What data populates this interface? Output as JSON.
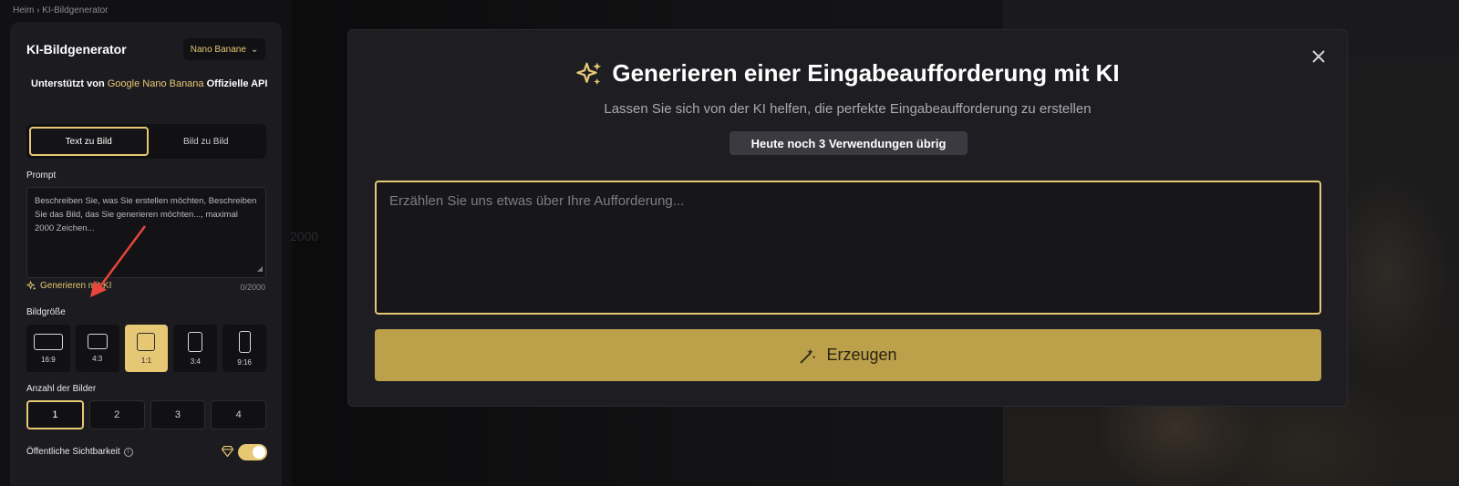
{
  "breadcrumb": "Heim › KI-Bildgenerator",
  "background": {
    "ghost_number": "2000"
  },
  "panel": {
    "title": "KI-Bildgenerator",
    "model_select": "Nano Banane",
    "powered_prefix": "Unterstützt von",
    "powered_brand": "Google Nano Banana",
    "powered_suffix": "Offizielle API",
    "tabs": [
      "Text zu Bild",
      "Bild zu Bild"
    ],
    "active_tab": "Text zu Bild",
    "prompt_label": "Prompt",
    "prompt_placeholder": "Beschreiben Sie, was Sie erstellen möchten, Beschreiben Sie das Bild, das Sie generieren möchten..., maximal 2000 Zeichen...",
    "generate_ai_label": "Generieren mit KI",
    "char_counter": "0/2000",
    "size_label": "Bildgröße",
    "sizes": [
      "16:9",
      "4:3",
      "1:1",
      "3:4",
      "9:16"
    ],
    "selected_size": "1:1",
    "count_label": "Anzahl der Bilder",
    "counts": [
      "1",
      "2",
      "3",
      "4"
    ],
    "selected_count": "1",
    "visibility_label": "Öffentliche Sichtbarkeit",
    "visibility_on": true
  },
  "modal": {
    "title": "Generieren einer Eingabeaufforderung mit KI",
    "subtitle": "Lassen Sie sich von der KI helfen, die perfekte Eingabeaufforderung zu erstellen",
    "usage_badge": "Heute noch 3 Verwendungen übrig",
    "input_placeholder": "Erzählen Sie uns etwas über Ihre Aufforderung...",
    "submit_label": "Erzeugen"
  },
  "colors": {
    "accent": "#e6c774",
    "button": "#bda04a",
    "panel": "#1c1c20",
    "modal": "#1e1e22"
  }
}
